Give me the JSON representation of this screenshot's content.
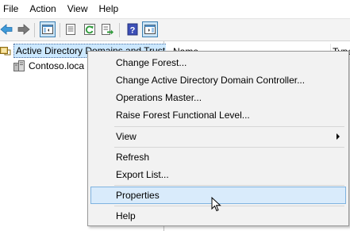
{
  "menubar": {
    "items": [
      "File",
      "Action",
      "View",
      "Help"
    ]
  },
  "toolbar": {
    "buttons": [
      "back-arrow",
      "forward-arrow",
      "show-hide-console-tree",
      "properties",
      "refresh",
      "export-list",
      "help",
      "show-hide-action-pane"
    ]
  },
  "tree": {
    "root_label": "Active Directory Domains and Trust",
    "child_label": "Contoso.loca"
  },
  "list": {
    "col_name": "Name",
    "col_type": "Type"
  },
  "context_menu": {
    "items": {
      "change_forest": "Change Forest...",
      "change_dc": "Change Active Directory Domain Controller...",
      "operations_master": "Operations Master...",
      "raise_forest": "Raise Forest Functional Level...",
      "view": "View",
      "refresh": "Refresh",
      "export_list": "Export List...",
      "properties": "Properties",
      "help": "Help"
    },
    "highlighted": "Properties"
  },
  "colors": {
    "highlight_bg": "#d9ebfb",
    "highlight_border": "#7fb3e0",
    "menu_bg": "#f2f2f2",
    "tree_selected": "#cce8ff"
  }
}
